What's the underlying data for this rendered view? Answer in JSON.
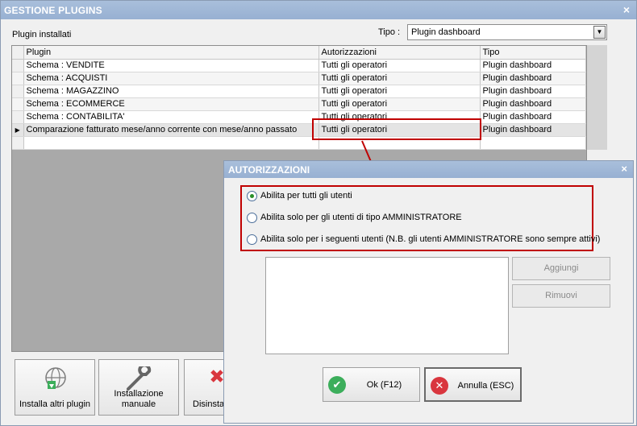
{
  "window": {
    "title": "GESTIONE PLUGINS",
    "close": "×"
  },
  "main": {
    "installed_label": "Plugin installati",
    "tipo_label": "Tipo :",
    "tipo_value": "Plugin dashboard",
    "columns": [
      "Plugin",
      "Autorizzazioni",
      "Tipo"
    ],
    "rows": [
      {
        "plugin": "Schema : VENDITE",
        "auth": "Tutti gli operatori",
        "tipo": "Plugin dashboard"
      },
      {
        "plugin": "Schema : ACQUISTI",
        "auth": "Tutti gli operatori",
        "tipo": "Plugin dashboard"
      },
      {
        "plugin": "Schema : MAGAZZINO",
        "auth": "Tutti gli operatori",
        "tipo": "Plugin dashboard"
      },
      {
        "plugin": "Schema : ECOMMERCE",
        "auth": "Tutti gli operatori",
        "tipo": "Plugin dashboard"
      },
      {
        "plugin": "Schema : CONTABILITA'",
        "auth": "Tutti gli operatori",
        "tipo": "Plugin dashboard"
      },
      {
        "plugin": "Comparazione fatturato mese/anno corrente con mese/anno passato",
        "auth": "Tutti gli operatori",
        "tipo": "Plugin dashboard"
      }
    ],
    "buttons": {
      "install_more": "Installa altri plugin",
      "manual_install_1": "Installazione",
      "manual_install_2": "manuale",
      "uninstall": "Disinstall"
    }
  },
  "dialog": {
    "title": "AUTORIZZAZIONI",
    "close": "×",
    "options": [
      "Abilita per tutti gli utenti",
      "Abilita solo per gli utenti di tipo AMMINISTRATORE",
      "Abilita solo per i seguenti utenti (N.B. gli utenti AMMINISTRATORE sono sempre attivi)"
    ],
    "selected_option": 0,
    "add_label": "Aggiungi",
    "remove_label": "Rimuovi",
    "ok_label": "Ok (F12)",
    "cancel_label": "Annulla (ESC)"
  },
  "colors": {
    "highlight": "#c00000",
    "titlebar": "#9fb6d6",
    "ok": "#3cae5b",
    "cancel": "#d9363e"
  }
}
